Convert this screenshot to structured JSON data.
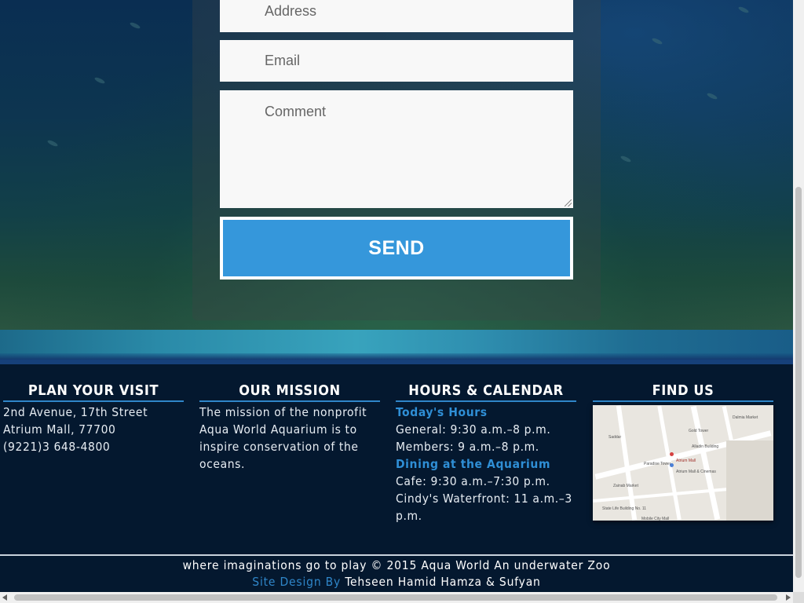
{
  "contact_form": {
    "address_placeholder": "Address",
    "email_placeholder": "Email",
    "comment_placeholder": "Comment",
    "send_label": "SEND"
  },
  "footer": {
    "plan_visit": {
      "heading": "PLAN YOUR VISIT",
      "lines": [
        "2nd Avenue, 17th Street",
        "Atrium Mall, 77700",
        "(9221)3 648-4800"
      ]
    },
    "mission": {
      "heading": "OUR MISSION",
      "text": "The mission of the nonprofit Aqua World Aquarium is to inspire conservation of the oceans."
    },
    "hours": {
      "heading": "HOURS & CALENDAR",
      "todays_hours_title": "Today's Hours",
      "general": "General: 9:30 a.m.–8 p.m.",
      "members": "Members: 9 a.m.–8 p.m.",
      "dining_title": "Dining at the Aquarium",
      "cafe": "Cafe: 9:30 a.m.–7:30 p.m.",
      "waterfront": "Cindy's Waterfront: 11 a.m.–3 p.m."
    },
    "find_us": {
      "heading": "FIND US",
      "map_labels": [
        "Gold Tower",
        "Atrium Mall",
        "Atrium Mall & Cinemas",
        "Dalmia Market",
        "State Life Building No. 11",
        "Paradise Tower",
        "Zainab Market",
        "Alladin Building",
        "Saddar",
        "Mobile City Mall"
      ]
    },
    "credits": {
      "tagline": "where imaginations go to play © 2015 Aqua World An underwater Zoo",
      "design_prefix": "Site Design By",
      "designers": "Tehseen Hamid Hamza & Sufyan"
    }
  },
  "colors": {
    "accent": "#2f86c9",
    "send_button": "#3597db",
    "footer_bg": "#04182f"
  }
}
